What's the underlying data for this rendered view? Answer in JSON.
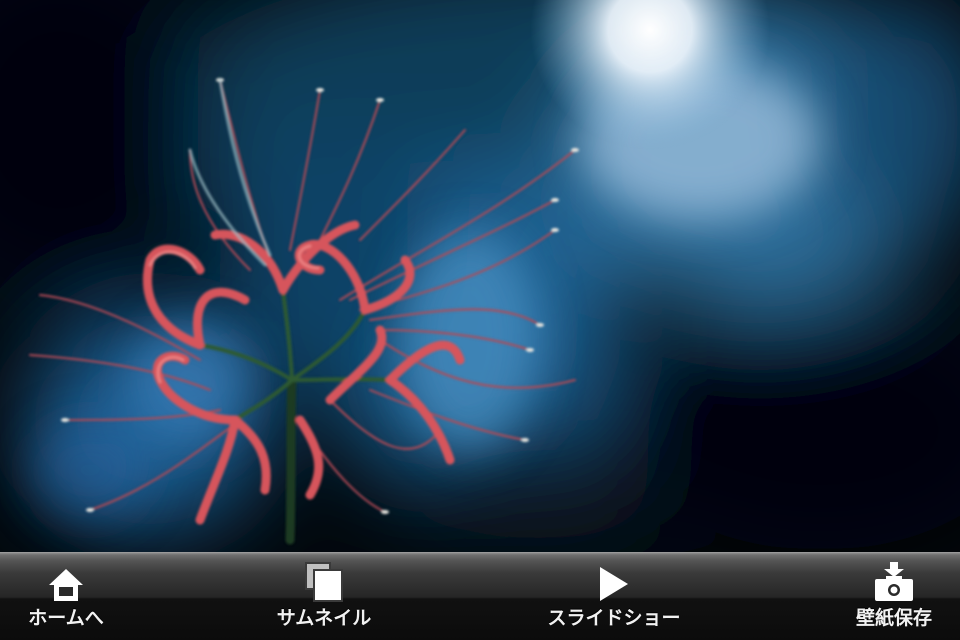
{
  "photo": {
    "subject": "red spider lily",
    "background_colors": [
      "#0b3b5a",
      "#4c8fc0",
      "#e8f1f8",
      "#02060a"
    ],
    "flower_color": "#d9555a"
  },
  "toolbar": {
    "items": [
      {
        "label": "ホームへ",
        "icon": "home-icon"
      },
      {
        "label": "サムネイル",
        "icon": "thumbnails-icon"
      },
      {
        "label": "スライドショー",
        "icon": "play-icon"
      },
      {
        "label": "壁紙保存",
        "icon": "save-wallpaper-icon"
      }
    ]
  }
}
